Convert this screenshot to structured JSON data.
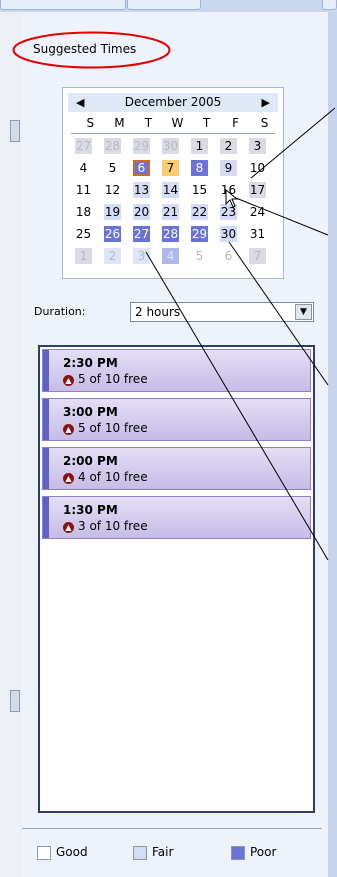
{
  "header": {
    "label": "Suggested Times"
  },
  "calendar": {
    "title": "December 2005",
    "prev_label": "◀",
    "next_label": "▶",
    "weekdays": [
      "S",
      "M",
      "T",
      "W",
      "T",
      "F",
      "S"
    ],
    "rows": [
      [
        "27",
        "28",
        "29",
        "30",
        "1",
        "2",
        "3"
      ],
      [
        "4",
        "5",
        "6",
        "7",
        "8",
        "9",
        "10"
      ],
      [
        "11",
        "12",
        "13",
        "14",
        "15",
        "16",
        "17"
      ],
      [
        "18",
        "19",
        "20",
        "21",
        "22",
        "23",
        "24"
      ],
      [
        "25",
        "26",
        "27",
        "28",
        "29",
        "30",
        "31"
      ],
      [
        "1",
        "2",
        "3",
        "4",
        "5",
        "6",
        "7"
      ]
    ]
  },
  "duration": {
    "label": "Duration:",
    "value": "2 hours",
    "dropdown_glyph": "▼"
  },
  "times": [
    {
      "time": "2:30 PM",
      "availability": "5 of 10 free"
    },
    {
      "time": "3:00 PM",
      "availability": "5 of 10 free"
    },
    {
      "time": "2:00 PM",
      "availability": "4 of 10 free"
    },
    {
      "time": "1:30 PM",
      "availability": "3 of 10 free"
    }
  ],
  "legend": {
    "good": "Good",
    "fair": "Fair",
    "poor": "Poor"
  },
  "colors": {
    "good": "#ffffff",
    "fair": "#d3dcf4",
    "poor": "#6a74d8",
    "selected_outline": "#d2691e",
    "today": "#f7cd70",
    "slot_accent": "#5e62c8",
    "annotation_red": "#e00000"
  },
  "icons": {
    "availability_icon": "up-arrow-circle-icon"
  }
}
